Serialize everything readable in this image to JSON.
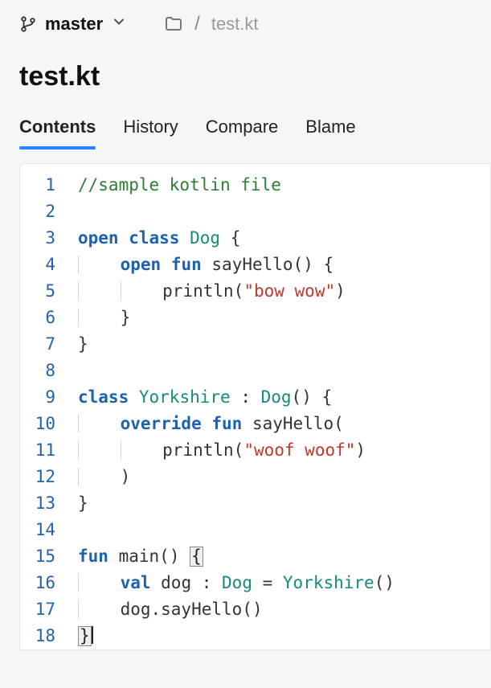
{
  "branch": "master",
  "breadcrumb": {
    "file": "test.kt"
  },
  "title": "test.kt",
  "tabs": [
    "Contents",
    "History",
    "Compare",
    "Blame"
  ],
  "active_tab_index": 0,
  "code": {
    "lines": [
      {
        "n": 1,
        "tokens": [
          [
            "//sample kotlin file",
            "comment"
          ]
        ]
      },
      {
        "n": 2,
        "tokens": []
      },
      {
        "n": 3,
        "tokens": [
          [
            "open",
            "kw"
          ],
          [
            " ",
            ""
          ],
          [
            "class",
            "kw"
          ],
          [
            " ",
            ""
          ],
          [
            "Dog",
            "type"
          ],
          [
            " {",
            "punc"
          ]
        ]
      },
      {
        "n": 4,
        "tokens": [
          [
            "    ",
            "guide"
          ],
          [
            "open",
            "kw"
          ],
          [
            " ",
            ""
          ],
          [
            "fun",
            "kw"
          ],
          [
            " ",
            ""
          ],
          [
            "sayHello",
            "fn"
          ],
          [
            "() {",
            "punc"
          ]
        ]
      },
      {
        "n": 5,
        "tokens": [
          [
            "    ",
            "guide"
          ],
          [
            "    ",
            "guide"
          ],
          [
            "println",
            "fn"
          ],
          [
            "(",
            "punc"
          ],
          [
            "\"bow wow\"",
            "str"
          ],
          [
            ")",
            "punc"
          ]
        ]
      },
      {
        "n": 6,
        "tokens": [
          [
            "    ",
            "guide"
          ],
          [
            "}",
            "punc"
          ]
        ]
      },
      {
        "n": 7,
        "tokens": [
          [
            "}",
            "punc"
          ]
        ]
      },
      {
        "n": 8,
        "tokens": []
      },
      {
        "n": 9,
        "tokens": [
          [
            "class",
            "kw"
          ],
          [
            " ",
            ""
          ],
          [
            "Yorkshire",
            "type"
          ],
          [
            " : ",
            "punc"
          ],
          [
            "Dog",
            "type"
          ],
          [
            "() {",
            "punc"
          ]
        ]
      },
      {
        "n": 10,
        "tokens": [
          [
            "    ",
            "guide"
          ],
          [
            "override",
            "kw"
          ],
          [
            " ",
            ""
          ],
          [
            "fun",
            "kw"
          ],
          [
            " ",
            ""
          ],
          [
            "sayHello",
            "fn"
          ],
          [
            "(",
            "punc"
          ]
        ]
      },
      {
        "n": 11,
        "tokens": [
          [
            "    ",
            "guide"
          ],
          [
            "    ",
            "guide"
          ],
          [
            "println",
            "fn"
          ],
          [
            "(",
            "punc"
          ],
          [
            "\"woof woof\"",
            "str"
          ],
          [
            ")",
            "punc"
          ]
        ]
      },
      {
        "n": 12,
        "tokens": [
          [
            "    ",
            "guide"
          ],
          [
            ")",
            "punc"
          ]
        ]
      },
      {
        "n": 13,
        "tokens": [
          [
            "}",
            "punc"
          ]
        ]
      },
      {
        "n": 14,
        "tokens": []
      },
      {
        "n": 15,
        "tokens": [
          [
            "fun",
            "kw"
          ],
          [
            " ",
            ""
          ],
          [
            "main",
            "fn"
          ],
          [
            "() ",
            "punc"
          ],
          [
            "{",
            "cursorbox"
          ]
        ]
      },
      {
        "n": 16,
        "tokens": [
          [
            "    ",
            "guide"
          ],
          [
            "val",
            "kw"
          ],
          [
            " dog : ",
            "punc"
          ],
          [
            "Dog",
            "type"
          ],
          [
            " = ",
            "punc"
          ],
          [
            "Yorkshire",
            "type"
          ],
          [
            "()",
            "punc"
          ]
        ]
      },
      {
        "n": 17,
        "tokens": [
          [
            "    ",
            "guide"
          ],
          [
            "dog.sayHello()",
            "punc"
          ]
        ]
      },
      {
        "n": 18,
        "tokens": [
          [
            "}",
            "cursorbox"
          ],
          [
            "",
            "caret"
          ]
        ]
      }
    ]
  }
}
